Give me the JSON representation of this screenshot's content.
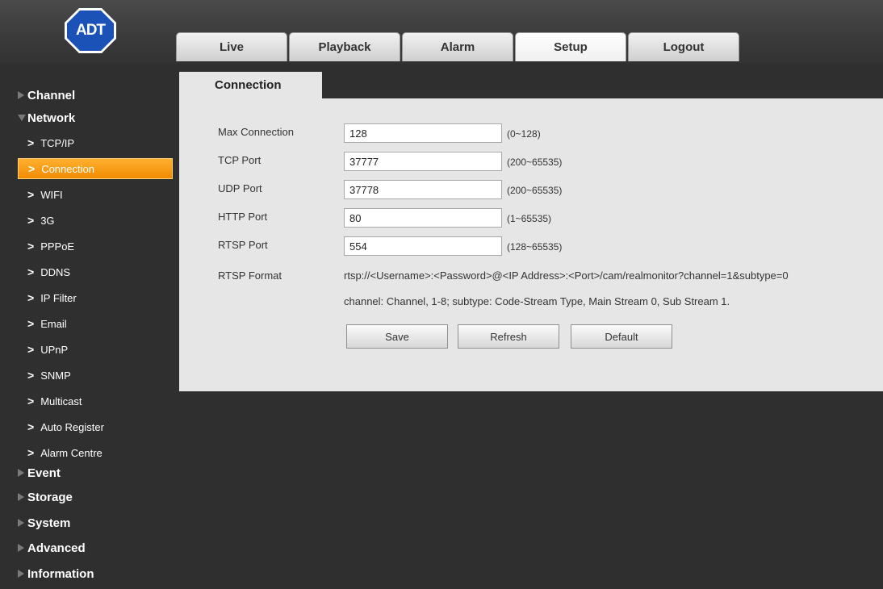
{
  "brand": {
    "logo_text": "ADT",
    "logo_color": "#1a52b8"
  },
  "top_tabs": [
    {
      "label": "Live"
    },
    {
      "label": "Playback"
    },
    {
      "label": "Alarm"
    },
    {
      "label": "Setup",
      "active": true
    },
    {
      "label": "Logout"
    }
  ],
  "sidebar": {
    "categories": {
      "channel": "Channel",
      "network": "Network",
      "event": "Event",
      "storage": "Storage",
      "system": "System",
      "advanced": "Advanced",
      "information": "Information"
    },
    "network_items": [
      {
        "label": "TCP/IP"
      },
      {
        "label": "Connection",
        "active": true
      },
      {
        "label": "WIFI"
      },
      {
        "label": "3G"
      },
      {
        "label": "PPPoE"
      },
      {
        "label": "DDNS"
      },
      {
        "label": "IP Filter"
      },
      {
        "label": "Email"
      },
      {
        "label": "UPnP"
      },
      {
        "label": "SNMP"
      },
      {
        "label": "Multicast"
      },
      {
        "label": "Auto Register"
      },
      {
        "label": "Alarm Centre"
      }
    ],
    "active_color": "#f59a10"
  },
  "content": {
    "tab_title": "Connection",
    "fields": [
      {
        "label": "Max Connection",
        "value": "128",
        "range": "(0~128)"
      },
      {
        "label": "TCP Port",
        "value": "37777",
        "range": "(200~65535)"
      },
      {
        "label": "UDP Port",
        "value": "37778",
        "range": "(200~65535)"
      },
      {
        "label": "HTTP Port",
        "value": "80",
        "range": "(1~65535)"
      },
      {
        "label": "RTSP Port",
        "value": "554",
        "range": "(128~65535)"
      }
    ],
    "rtsp_format_label": "RTSP Format",
    "rtsp_format_value": "rtsp://<Username>:<Password>@<IP Address>:<Port>/cam/realmonitor?channel=1&subtype=0",
    "rtsp_note": "channel: Channel, 1-8; subtype: Code-Stream Type, Main Stream 0, Sub Stream 1.",
    "buttons": {
      "save": "Save",
      "refresh": "Refresh",
      "default": "Default"
    }
  }
}
